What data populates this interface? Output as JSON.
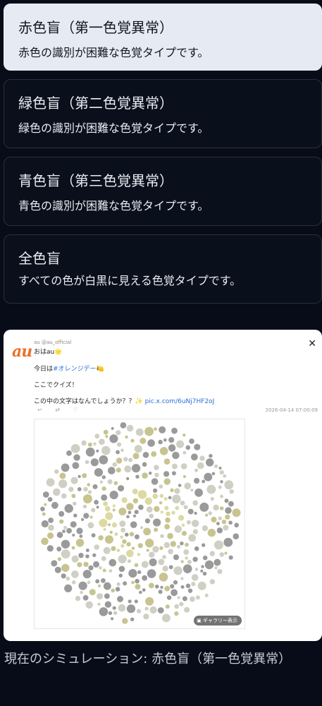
{
  "options": [
    {
      "title": "赤色盲（第一色覚異常）",
      "desc": "赤色の識別が困難な色覚タイプです。",
      "selected": true
    },
    {
      "title": "緑色盲（第二色覚異常）",
      "desc": "緑色の識別が困難な色覚タイプです。",
      "selected": false
    },
    {
      "title": "青色盲（第三色覚異常）",
      "desc": "青色の識別が困難な色覚タイプです。",
      "selected": false
    },
    {
      "title": "全色盲",
      "desc": "すべての色が白黒に見える色覚タイプです。",
      "selected": false
    }
  ],
  "tweet": {
    "logo_text": "au",
    "handle": "au @au_official",
    "close_glyph": "✕",
    "greeting": "おはau🌟",
    "line2_prefix": "今日は",
    "hashtag": "#オレンジデー🍋",
    "line3": "ここでクイズ！",
    "line4_prefix": "この中の文字はなんでしょうか？？✨",
    "link": "pic.x.com/6uNj7HF2oJ",
    "actions": "↩ ⇄ ♡",
    "timestamp": "2026-04-14 07:00:09",
    "gallery_label": "ギャラリー表示",
    "gallery_icon": "gallery-icon"
  },
  "status": {
    "label": "現在のシミュレーション: 赤色盲（第一色覚異常）"
  },
  "colors": {
    "background": "#070c18",
    "selected_bg": "#e6ebf3",
    "card_border": "#2a2f3a",
    "link": "#2b6fd6",
    "logo": "#e8732b",
    "dot_gray": "#9a9a9a",
    "dot_light": "#cfcfc4",
    "dot_khaki": "#c8c48f",
    "dot_yellow": "#dcd9a2"
  }
}
